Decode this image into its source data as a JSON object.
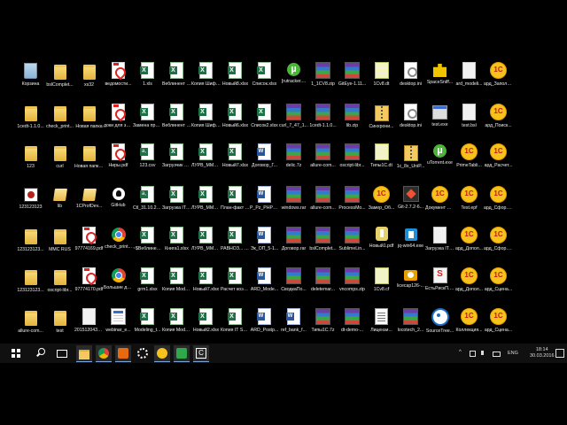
{
  "desktop": {
    "rows": [
      [
        {
          "label": "Корзина",
          "icon": "recycle-bin"
        },
        {
          "label": "bslComplet...",
          "icon": "folder"
        },
        {
          "label": "xs32",
          "icon": "folder"
        },
        {
          "label": "ведомости...",
          "icon": "pdf"
        },
        {
          "label": "1.xls",
          "icon": "xls"
        },
        {
          "label": "Веблинент баги.xlsx",
          "icon": "xls"
        },
        {
          "label": "Копия Шифры по...",
          "icon": "xls"
        },
        {
          "label": "Новый8.xlsx",
          "icon": "xls"
        },
        {
          "label": "Список.xlsx",
          "icon": "xls"
        },
        {
          "label": "[rutracker....",
          "icon": "torrent"
        },
        {
          "label": "1_1CV8.zip",
          "icon": "rar"
        },
        {
          "label": "GitEye-1.11...",
          "icon": "rar"
        },
        {
          "label": "1Cv8.dt",
          "icon": "note"
        },
        {
          "label": "desktop.ini",
          "icon": "ini"
        },
        {
          "label": "SpaceSniff...",
          "icon": "puzzle"
        },
        {
          "label": "ard_modeli...",
          "icon": "file"
        },
        {
          "label": "ард_Заполн...",
          "icon": "1c"
        }
      ],
      [
        {
          "label": "1cedt-1.1.0...",
          "icon": "folder"
        },
        {
          "label": "check_print...",
          "icon": "folder"
        },
        {
          "label": "Новая папка",
          "icon": "folder"
        },
        {
          "label": "доки для замен на...",
          "icon": "pdf"
        },
        {
          "label": "Замена проводок ...",
          "icon": "xls"
        },
        {
          "label": "Веблинент баги.xlsx",
          "icon": "xls"
        },
        {
          "label": "Копия Шифры по...",
          "icon": "xls"
        },
        {
          "label": "Новый6.xlsx",
          "icon": "xls"
        },
        {
          "label": "Список2.xlsx",
          "icon": "xls"
        },
        {
          "label": "curl_7_47_1...",
          "icon": "rar"
        },
        {
          "label": "1cedt-1.1.0...",
          "icon": "rar"
        },
        {
          "label": "lib.zip",
          "icon": "rar"
        },
        {
          "label": "Синхрони...",
          "icon": "zip"
        },
        {
          "label": "desktop.ini",
          "icon": "ini"
        },
        {
          "label": "test.exe",
          "icon": "exe"
        },
        {
          "label": "test.bsl",
          "icon": "file"
        },
        {
          "label": "ард_Поиск...",
          "icon": "1c"
        }
      ],
      [
        {
          "label": "123",
          "icon": "folder"
        },
        {
          "label": "curl",
          "icon": "folder"
        },
        {
          "label": "Новая папка (2)",
          "icon": "folder"
        },
        {
          "label": "Ниры.pdf",
          "icon": "pdf"
        },
        {
          "label": "123.csv",
          "icon": "csv"
        },
        {
          "label": "Загрузчик шифров ...",
          "icon": "xls"
        },
        {
          "label": "ЛУРВ_MMC_Декабрь.xlsx",
          "icon": "xls"
        },
        {
          "label": "Новый7.xlsx",
          "icon": "xls"
        },
        {
          "label": "Договор_Г...",
          "icon": "doc"
        },
        {
          "label": "delic.7z",
          "icon": "rar"
        },
        {
          "label": "allure-com...",
          "icon": "rar"
        },
        {
          "label": "oscript-libr...",
          "icon": "rar"
        },
        {
          "label": "Типы1С.dt",
          "icon": "note"
        },
        {
          "label": "1c_8x_UniP...",
          "icon": "zip"
        },
        {
          "label": "uTorrent.exe",
          "icon": "torrent"
        },
        {
          "label": "PrimeTabli...",
          "icon": "1c"
        },
        {
          "label": "ард_Расчет...",
          "icon": "1c"
        }
      ],
      [
        {
          "label": "123123123",
          "icon": "photo"
        },
        {
          "label": "lib",
          "icon": "folder-open"
        },
        {
          "label": "1CProfDev...",
          "icon": "folder-open"
        },
        {
          "label": "GitHub",
          "icon": "github"
        },
        {
          "label": "Ctl_31.10.2... 19.23.11.csv",
          "icon": "csv"
        },
        {
          "label": "Загрузка IT Expences_...",
          "icon": "xls"
        },
        {
          "label": "ЛУРВ_MMC_Февраль.xlsx",
          "icon": "xls"
        },
        {
          "label": "План-факт анализ.xlsx",
          "icon": "xls"
        },
        {
          "label": "P_Pz_PHPp...",
          "icon": "doc"
        },
        {
          "label": "windows.rar",
          "icon": "rar"
        },
        {
          "label": "allure-com...",
          "icon": "rar"
        },
        {
          "label": "ProcessMo...",
          "icon": "rar"
        },
        {
          "label": "Замер_Об...",
          "icon": "1c"
        },
        {
          "label": "Git-2.7.2-6...",
          "icon": "git"
        },
        {
          "label": "Документ ЩО.xsl",
          "icon": "1c"
        },
        {
          "label": "Test.epf",
          "icon": "1c"
        },
        {
          "label": "ард_Сфор... (WL).epf",
          "icon": "1c"
        }
      ],
      [
        {
          "label": "123123123...",
          "icon": "folder"
        },
        {
          "label": "MMC RUS",
          "icon": "folder"
        },
        {
          "label": "97774169.pdf",
          "icon": "pdf"
        },
        {
          "label": "check_print...",
          "icon": "chrome"
        },
        {
          "label": "~$Веблинент баги.xlsx",
          "icon": "xls"
        },
        {
          "label": "Книга1.xlsx",
          "icon": "xls"
        },
        {
          "label": "ЛУРВ_MMC_Январь.xlsx",
          "icon": "xls"
        },
        {
          "label": "РАВНОЗ... v2.0.XLSX",
          "icon": "xls"
        },
        {
          "label": "Эк_ОП_5-1...",
          "icon": "doc"
        },
        {
          "label": "Договор.rar",
          "icon": "rar"
        },
        {
          "label": "bslComplet...",
          "icon": "rar"
        },
        {
          "label": "SublimeLin...",
          "icon": "rar"
        },
        {
          "label": "Новый1.pdf",
          "icon": "lamp"
        },
        {
          "label": "jq-win64.exe",
          "icon": "vm"
        },
        {
          "label": "Загрузка IT Expences",
          "icon": "file"
        },
        {
          "label": "ард_Допол...",
          "icon": "1c"
        },
        {
          "label": "ард_Сфор... (WL).epf",
          "icon": "1c"
        }
      ],
      [
        {
          "label": "123123123...",
          "icon": "folder"
        },
        {
          "label": "oscript-libr...",
          "icon": "folder"
        },
        {
          "label": "97774170.pdf",
          "icon": "pdf"
        },
        {
          "label": "Большие документ...",
          "icon": "chrome"
        },
        {
          "label": "grm1.xlsx",
          "icon": "xls"
        },
        {
          "label": "Копия Models_20...",
          "icon": "xls"
        },
        {
          "label": "Новый7.xlsx",
          "icon": "xls"
        },
        {
          "label": "Расчет коэффици...",
          "icon": "xls"
        },
        {
          "label": "ARD_Mode...",
          "icon": "doc"
        },
        {
          "label": "СводкаПо...",
          "icon": "rar"
        },
        {
          "label": "deletemar...",
          "icon": "rar"
        },
        {
          "label": "vncomps.zip",
          "icon": "rar"
        },
        {
          "label": "1Cv8.cf",
          "icon": "note"
        },
        {
          "label": "licecap126-...",
          "icon": "camera"
        },
        {
          "label": "ЕстьРискП... — backup...",
          "icon": "eset"
        },
        {
          "label": "ард_Допол...",
          "icon": "1c"
        },
        {
          "label": "ард_Сцена...",
          "icon": "1c"
        }
      ],
      [
        {
          "label": "allure-com...",
          "icon": "folder"
        },
        {
          "label": "test",
          "icon": "folder"
        },
        {
          "label": "2015120431...",
          "icon": "file"
        },
        {
          "label": "webinar_e...",
          "icon": "web"
        },
        {
          "label": "Modeling_t...",
          "icon": "xls"
        },
        {
          "label": "Копия Models_20...",
          "icon": "xls"
        },
        {
          "label": "Новый2.xlsx",
          "icon": "xls"
        },
        {
          "label": "Копия IT Services.xlsx",
          "icon": "xls"
        },
        {
          "label": "ARD_Postp...",
          "icon": "doc"
        },
        {
          "label": "ref_bank_f...",
          "icon": "doc"
        },
        {
          "label": "Типы1С.7z",
          "icon": "rar"
        },
        {
          "label": "dt-demo-...",
          "icon": "rar"
        },
        {
          "label": "Лицензи...",
          "icon": "text"
        },
        {
          "label": "locotech_2...",
          "icon": "rar"
        },
        {
          "label": "SourceTree...",
          "icon": "sourcetree"
        },
        {
          "label": "Коллекция...",
          "icon": "1c"
        },
        {
          "label": "ард_Сцена...",
          "icon": "1c"
        }
      ]
    ]
  },
  "taskbar": {
    "apps": [
      {
        "name": "file-explorer",
        "color": "#f4c95d"
      },
      {
        "name": "chrome",
        "color": "#db4437"
      },
      {
        "name": "tool-orange",
        "color": "#e86a10"
      },
      {
        "name": "settings-gear",
        "color": "#ffffff"
      },
      {
        "name": "1c-enterprise",
        "color": "#f7c21b"
      },
      {
        "name": "app-green",
        "color": "#2ea84a"
      },
      {
        "name": "app-c",
        "color": "#ffffff"
      }
    ],
    "tray": {
      "language": "ENG",
      "time": "18:14",
      "date": "30.03.2016"
    }
  }
}
